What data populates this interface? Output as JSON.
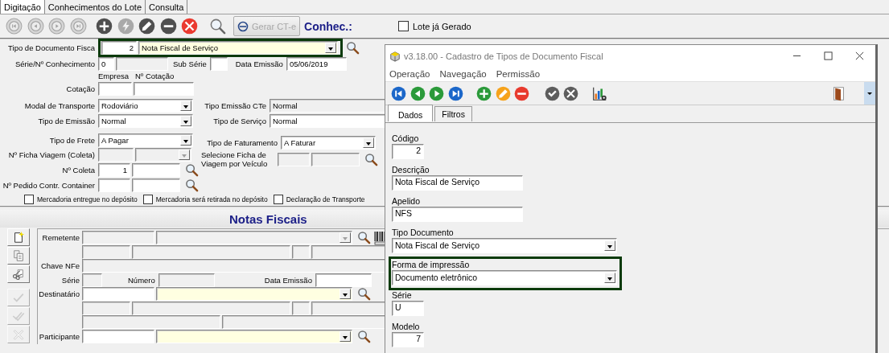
{
  "tabs": [
    {
      "label": "Digitação",
      "selected": true
    },
    {
      "label": "Conhecimentos do Lote",
      "selected": false
    },
    {
      "label": "Consulta",
      "selected": false
    }
  ],
  "toolbar": {
    "buttons": [
      {
        "kind": "first",
        "disabled": true
      },
      {
        "kind": "prev",
        "disabled": true
      },
      {
        "kind": "next",
        "disabled": true
      },
      {
        "kind": "last",
        "disabled": true
      },
      {
        "kind": "add",
        "disabled": false
      },
      {
        "kind": "run",
        "disabled": true
      },
      {
        "kind": "edit",
        "disabled": false
      },
      {
        "kind": "remove",
        "disabled": false
      },
      {
        "kind": "cancel",
        "disabled": false
      },
      {
        "kind": "search",
        "disabled": false
      }
    ],
    "generate_button": {
      "label": "Gerar CT-e",
      "disabled": true
    },
    "record_label": "Conhec.:",
    "batch_checkbox": {
      "label": "Lote já Gerado",
      "checked": false
    }
  },
  "main_form": {
    "document_type": {
      "label": "Tipo de Documento Fisca",
      "code": "2",
      "value": "Nota Fiscal de Serviço",
      "highlighted": true
    },
    "series": {
      "label": "Série/Nº Conhecimento",
      "value": "0"
    },
    "sub_series": {
      "label": "Sub Série"
    },
    "issue_date": {
      "label": "Data Emissão",
      "value": "05/06/2019"
    },
    "quote_headers": [
      "Empresa",
      "Nº Cotação"
    ],
    "quote": {
      "label": "Cotação"
    },
    "transport_mode": {
      "label": "Modal de Transporte",
      "value": "Rodoviário"
    },
    "emission_type": {
      "label": "Tipo de Emissão",
      "value": "Normal"
    },
    "freight_type": {
      "label": "Tipo de Frete",
      "value": "A Pagar"
    },
    "trip_sheet": {
      "label": "Nº Ficha Viagem (Coleta)",
      "disabled": true
    },
    "collection": {
      "label": "Nº Coleta",
      "value": "1"
    },
    "container": {
      "label": "Nº Pedido Contr. Container"
    },
    "cte_emission": {
      "label": "Tipo Emissão CTe",
      "value": "Normal"
    },
    "service_type": {
      "label": "Tipo de Serviço",
      "value": "Normal"
    },
    "billing_type": {
      "label": "Tipo de Faturamento",
      "value": "A Faturar"
    },
    "vehicle_trip": {
      "label": "Selecione Ficha de Viagem por Veículo"
    },
    "checkboxes": [
      {
        "label": "Mercadoria entregue no depósito",
        "checked": false
      },
      {
        "label": "Mercadoria será retirada no depósito",
        "checked": false
      },
      {
        "label": "Declaração de Transporte",
        "checked": false
      }
    ]
  },
  "notes_panel": {
    "title": "Notas Fiscais",
    "side_buttons": [
      {
        "kind": "new",
        "disabled": false
      },
      {
        "kind": "copy",
        "disabled": false
      },
      {
        "kind": "cut",
        "disabled": false
      },
      {
        "kind": "check",
        "disabled": true
      },
      {
        "kind": "check_all",
        "disabled": true
      },
      {
        "kind": "cancel",
        "disabled": true
      }
    ],
    "sender_label": "Remetente",
    "nfe_key_label": "Chave NFe",
    "series_label": "Série",
    "number_label": "Número",
    "issue_date_label": "Data Emissão",
    "recipient_label": "Destinatário",
    "participant_label": "Participante"
  },
  "dialog": {
    "title": "v3.18.00 - Cadastro de Tipos de Documento Fiscal",
    "menu": [
      "Operação",
      "Navegação",
      "Permissão"
    ],
    "toolbar": [
      {
        "kind": "first"
      },
      {
        "kind": "prev"
      },
      {
        "kind": "next"
      },
      {
        "kind": "last"
      },
      {
        "kind": "add"
      },
      {
        "kind": "edit"
      },
      {
        "kind": "remove"
      },
      {
        "kind": "confirm"
      },
      {
        "kind": "cancel"
      },
      {
        "kind": "report"
      },
      {
        "kind": "exit"
      }
    ],
    "tabs": [
      {
        "label": "Dados",
        "selected": true
      },
      {
        "label": "Filtros",
        "selected": false
      }
    ],
    "fields": [
      {
        "kind": "number",
        "label": "Código",
        "value": "2",
        "highlighted": false
      },
      {
        "kind": "text",
        "label": "Descrição",
        "value": "Nota Fiscal de Serviço",
        "highlighted": false
      },
      {
        "kind": "text",
        "label": "Apelido",
        "value": "NFS",
        "highlighted": false
      },
      {
        "kind": "select",
        "label": "Tipo Documento",
        "value": "Nota Fiscal de Serviço",
        "highlighted": false
      },
      {
        "kind": "select",
        "label": "Forma de impressão",
        "value": "Documento eletrônico",
        "highlighted": true
      },
      {
        "kind": "short",
        "label": "Série",
        "value": "U",
        "highlighted": false
      },
      {
        "kind": "number",
        "label": "Modelo",
        "value": "7",
        "highlighted": false
      }
    ]
  }
}
